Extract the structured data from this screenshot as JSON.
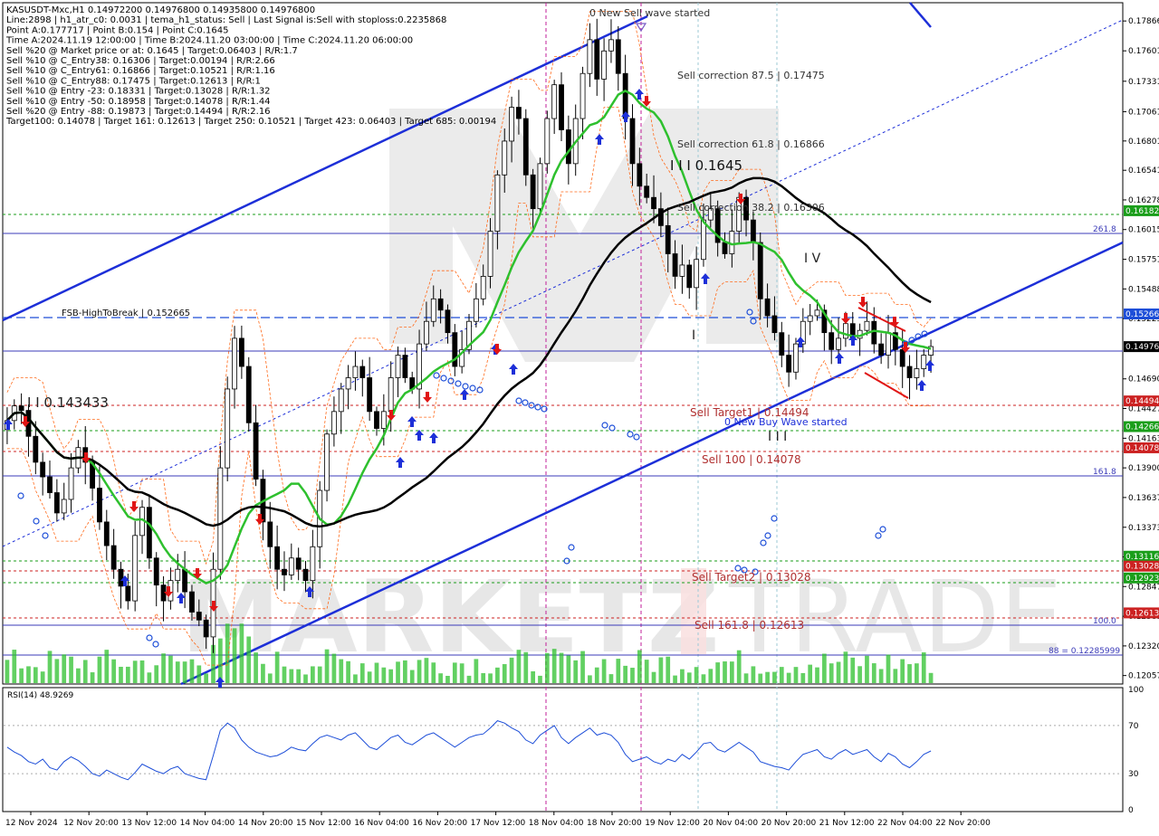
{
  "header": {
    "lines": [
      "KASUSDT-Mxc,H1  0.14972200 0.14976800 0.14935800 0.14976800",
      "Line:2898  |  h1_atr_c0: 0.0031  |  tema_h1_status: Sell  |  Last Signal is:Sell with stoploss:0.2235868",
      "Point A:0.177717  |  Point B:0.154  |  Point C:0.1645",
      "Time A:2024.11.19 12:00:00  |  Time B:2024.11.20 03:00:00  |  Time C:2024.11.20 06:00:00",
      "Sell %20 @ Market price or at: 0.1645  |  Target:0.06403  |  R/R:1.7",
      "Sell %10 @ C_Entry38: 0.16306  |  Target:0.00194  |  R/R:2.66",
      "Sell %10 @ C_Entry61: 0.16866  |  Target:0.10521  |  R/R:1.16",
      "Sell %10 @ C_Entry88: 0.17475  |  Target:0.12613  |  R/R:1",
      "Sell %10 @ Entry -23: 0.18331  |  Target:0.13028  |  R/R:1.32",
      "Sell %10 @ Entry -50: 0.18958  |  Target:0.14078  |  R/R:1.44",
      "Sell %20 @ Entry -88: 0.19873  |  Target:0.14494  |  R/R:2.16",
      "Target100: 0.14078  |  Target 161: 0.12613  |  Target 250: 0.10521  |  Target 423: 0.06403  |  Target 685: 0.00194"
    ]
  },
  "annotations": {
    "wave_sell": "0 New Sell wave started",
    "wave_buy": "0 New Buy Wave started",
    "corr_875": "Sell correction 87.5 | 0.17475",
    "corr_618": "Sell correction 61.8 | 0.16866",
    "corr_382": "Sell correction 38.2 | 0.16306",
    "point_c": "I I I 0.1645",
    "left_level": "I I 0.143433",
    "fsb": "FSB-HighToBreak  |  0.152665",
    "target1": "Sell Target1 | 0.14494",
    "sell100": "Sell 100 | 0.14078",
    "target2": "Sell Target2 | 0.13028",
    "sell1618": "Sell 161.8 | 0.12613",
    "fib_2618": "261.8",
    "fib_1618": "161.8",
    "fib_100": "100.0",
    "fib_88": "88 = 0.12285999",
    "marker_iv": "I V",
    "marker_iii": "I I I",
    "marker_i": "I",
    "watermark_left": "MARKETZ",
    "watermark_right": "TRADE"
  },
  "axis": {
    "y_ticks": [
      "0.17866",
      "0.17601",
      "0.17331",
      "0.17061",
      "0.16801",
      "0.16541",
      "0.16278",
      "0.16015",
      "0.15751",
      "0.15488",
      "0.15225",
      "0.14690",
      "0.14427",
      "0.14163",
      "0.13900",
      "0.13637",
      "0.13373",
      "0.13110",
      "0.12847",
      "0.12583",
      "0.12320",
      "0.12057"
    ],
    "y_tick_values": [
      0.17866,
      0.17601,
      0.17331,
      0.17061,
      0.16801,
      0.16541,
      0.16278,
      0.16015,
      0.15751,
      0.15488,
      0.15225,
      0.1469,
      0.14427,
      0.14163,
      0.139,
      0.13637,
      0.13373,
      0.1311,
      0.12847,
      0.12583,
      0.1232,
      0.12057
    ],
    "x_ticks": [
      "12 Nov 2024",
      "12 Nov 20:00",
      "13 Nov 12:00",
      "14 Nov 04:00",
      "14 Nov 20:00",
      "15 Nov 12:00",
      "16 Nov 04:00",
      "16 Nov 20:00",
      "17 Nov 12:00",
      "18 Nov 04:00",
      "18 Nov 20:00",
      "19 Nov 12:00",
      "20 Nov 04:00",
      "20 Nov 20:00",
      "21 Nov 12:00",
      "22 Nov 04:00",
      "22 Nov 20:00"
    ],
    "rsi_ticks": [
      "100",
      "70",
      "30",
      "0"
    ],
    "rsi_tick_values": [
      100,
      70,
      30,
      0
    ]
  },
  "price_tags": [
    {
      "label": "0.16182",
      "value": 0.16182,
      "color": "#1a9e1a"
    },
    {
      "label": "0.15266",
      "value": 0.15266,
      "color": "#1d4ed8"
    },
    {
      "label": "0.14976",
      "value": 0.14976,
      "color": "#000000"
    },
    {
      "label": "0.14494",
      "value": 0.14494,
      "color": "#cc2222"
    },
    {
      "label": "0.14266",
      "value": 0.14266,
      "color": "#1a9e1a"
    },
    {
      "label": "0.14078",
      "value": 0.14078,
      "color": "#cc2222"
    },
    {
      "label": "0.13116",
      "value": 0.13116,
      "color": "#1a9e1a"
    },
    {
      "label": "0.13028",
      "value": 0.13028,
      "color": "#cc2222"
    },
    {
      "label": "0.12923",
      "value": 0.12923,
      "color": "#1a9e1a"
    },
    {
      "label": "0.12613",
      "value": 0.12613,
      "color": "#cc2222"
    }
  ],
  "rsi": {
    "label": "RSI(14) 48.9269",
    "levels": [
      70,
      30
    ]
  },
  "chart_data": {
    "type": "candlestick",
    "symbol": "KASUSDT-Mxc",
    "timeframe": "H1",
    "ylim": [
      0.1199,
      0.1802
    ],
    "last_price": 0.149768,
    "close_series": [
      0.1432,
      0.1445,
      0.1441,
      0.1418,
      0.1395,
      0.1382,
      0.1368,
      0.135,
      0.1362,
      0.139,
      0.1408,
      0.1395,
      0.1372,
      0.1342,
      0.1321,
      0.13,
      0.1285,
      0.1272,
      0.133,
      0.1355,
      0.131,
      0.1286,
      0.1272,
      0.129,
      0.13,
      0.128,
      0.1262,
      0.1255,
      0.124,
      0.13,
      0.139,
      0.146,
      0.1505,
      0.148,
      0.143,
      0.138,
      0.1342,
      0.132,
      0.13,
      0.1295,
      0.131,
      0.13,
      0.129,
      0.132,
      0.137,
      0.142,
      0.144,
      0.146,
      0.147,
      0.148,
      0.147,
      0.144,
      0.1425,
      0.144,
      0.147,
      0.149,
      0.147,
      0.146,
      0.15,
      0.152,
      0.154,
      0.153,
      0.151,
      0.148,
      0.1495,
      0.152,
      0.154,
      0.156,
      0.16,
      0.165,
      0.168,
      0.171,
      0.17,
      0.165,
      0.162,
      0.166,
      0.17,
      0.173,
      0.169,
      0.166,
      0.17,
      0.174,
      0.177,
      0.1735,
      0.176,
      0.177,
      0.174,
      0.17,
      0.166,
      0.164,
      0.163,
      0.162,
      0.1605,
      0.158,
      0.156,
      0.157,
      0.155,
      0.1575,
      0.161,
      0.162,
      0.159,
      0.158,
      0.16,
      0.163,
      0.161,
      0.159,
      0.154,
      0.1525,
      0.151,
      0.149,
      0.1475,
      0.15,
      0.152,
      0.1525,
      0.153,
      0.151,
      0.1495,
      0.1505,
      0.1518,
      0.1505,
      0.1512,
      0.152,
      0.15,
      0.149,
      0.151,
      0.1495,
      0.148,
      0.147,
      0.1478,
      0.149,
      0.14977
    ],
    "indicators": [
      {
        "name": "Moving Average (green)",
        "color": "#2ec02e"
      },
      {
        "name": "Moving Average (black)",
        "color": "#000000"
      }
    ],
    "levels": [
      {
        "label": "Sell correction 87.5",
        "value": 0.17475
      },
      {
        "label": "Sell correction 61.8",
        "value": 0.16866
      },
      {
        "label": "Sell correction 38.2",
        "value": 0.16306
      },
      {
        "label": "FSB-HighToBreak",
        "value": 0.152665
      },
      {
        "label": "Sell Target1",
        "value": 0.14494
      },
      {
        "label": "Sell 100",
        "value": 0.14078
      },
      {
        "label": "Sell Target2",
        "value": 0.13028
      },
      {
        "label": "Sell 161.8",
        "value": 0.12613
      }
    ],
    "rsi_series": [
      52,
      48,
      45,
      40,
      38,
      42,
      35,
      33,
      40,
      44,
      41,
      36,
      30,
      28,
      33,
      30,
      27,
      25,
      31,
      38,
      35,
      32,
      30,
      34,
      36,
      30,
      28,
      26,
      25,
      45,
      66,
      72,
      68,
      58,
      52,
      48,
      46,
      44,
      45,
      48,
      52,
      50,
      49,
      55,
      60,
      62,
      60,
      58,
      62,
      64,
      58,
      52,
      50,
      55,
      60,
      62,
      56,
      54,
      58,
      62,
      64,
      60,
      56,
      52,
      56,
      60,
      62,
      63,
      68,
      74,
      72,
      68,
      65,
      58,
      55,
      62,
      66,
      70,
      60,
      55,
      60,
      64,
      68,
      62,
      64,
      62,
      56,
      46,
      40,
      42,
      44,
      40,
      38,
      42,
      40,
      46,
      42,
      48,
      55,
      56,
      50,
      48,
      52,
      56,
      52,
      48,
      40,
      38,
      36,
      35,
      33,
      40,
      46,
      48,
      50,
      44,
      42,
      47,
      50,
      46,
      48,
      50,
      44,
      40,
      47,
      44,
      38,
      35,
      40,
      46,
      48.9
    ]
  }
}
